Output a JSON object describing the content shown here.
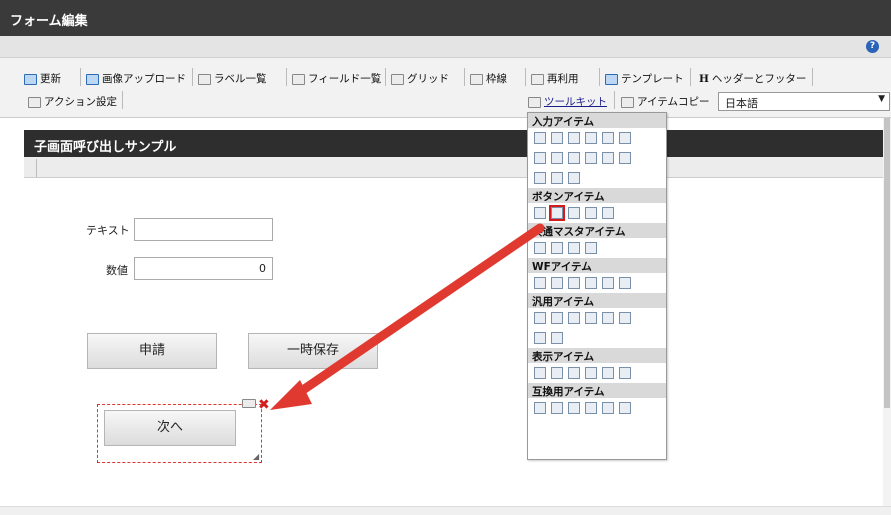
{
  "window": {
    "title": "フォーム編集",
    "help_glyph": "?"
  },
  "toolbar": {
    "update": "更新",
    "image_upload": "画像アップロード",
    "label_list": "ラベル一覧",
    "field_list": "フィールド一覧",
    "grid": "グリッド",
    "frame": "枠線",
    "reuse": "再利用",
    "template": "テンプレート",
    "header_footer_glyph": "H",
    "header_footer": "ヘッダーとフッター",
    "action_settings": "アクション設定",
    "toolkit": "ツールキット",
    "item_copy": "アイテムコピー",
    "language": "日本語",
    "language_arrow": "▼"
  },
  "form": {
    "title": "子画面呼び出しサンプル",
    "text_label": "テキスト",
    "text_value": "",
    "number_label": "数値",
    "number_value": "0",
    "apply_button": "申請",
    "temp_save_button": "一時保存",
    "next_button": "次へ",
    "delete_glyph": "✖",
    "resize_glyph": "◢"
  },
  "toolkit_popup": {
    "sections": [
      "入力アイテム",
      "ボタンアイテム",
      "共通マスタアイテム",
      "WFアイテム",
      "汎用アイテム",
      "表示アイテム",
      "互換用アイテム"
    ]
  },
  "colors": {
    "titlebar": "#3a3a3a",
    "highlight": "#d61a1a",
    "arrow": "#e03a30"
  }
}
